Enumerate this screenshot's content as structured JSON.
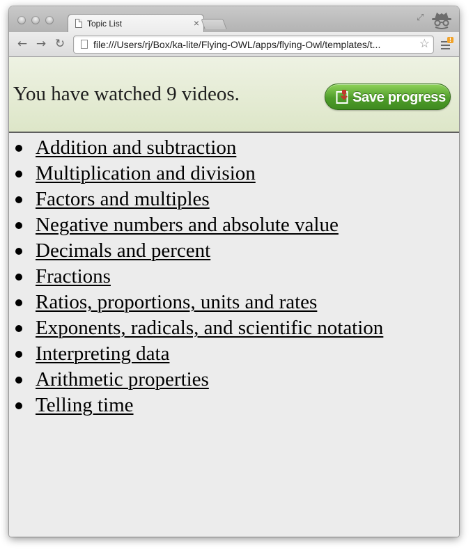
{
  "browser": {
    "tab": {
      "title": "Topic List",
      "close_glyph": "×"
    },
    "nav": {
      "back_glyph": "←",
      "forward_glyph": "→",
      "reload_glyph": "↻"
    },
    "omnibox": {
      "url": "file:///Users/rj/Box/ka-lite/Flying-OWL/apps/flying-Owl/templates/t...",
      "star_glyph": "☆"
    },
    "menu": {
      "badge": "!"
    },
    "icons": {
      "window": "resize-fullscreen-icon",
      "profile": "incognito-icon",
      "menu": "wrench-menu-icon"
    }
  },
  "header": {
    "watched_text": "You have watched 9 videos.",
    "save_button": {
      "label": "Save progress",
      "icon": "save-download-icon",
      "color": "#4f9d2a"
    }
  },
  "topics": [
    {
      "label": "Addition and subtraction"
    },
    {
      "label": "Multiplication and division"
    },
    {
      "label": "Factors and multiples"
    },
    {
      "label": "Negative numbers and absolute value"
    },
    {
      "label": "Decimals and percent"
    },
    {
      "label": "Fractions"
    },
    {
      "label": "Ratios, proportions, units and rates"
    },
    {
      "label": "Exponents, radicals, and scientific notation"
    },
    {
      "label": "Interpreting data"
    },
    {
      "label": "Arithmetic properties"
    },
    {
      "label": "Telling time"
    }
  ]
}
